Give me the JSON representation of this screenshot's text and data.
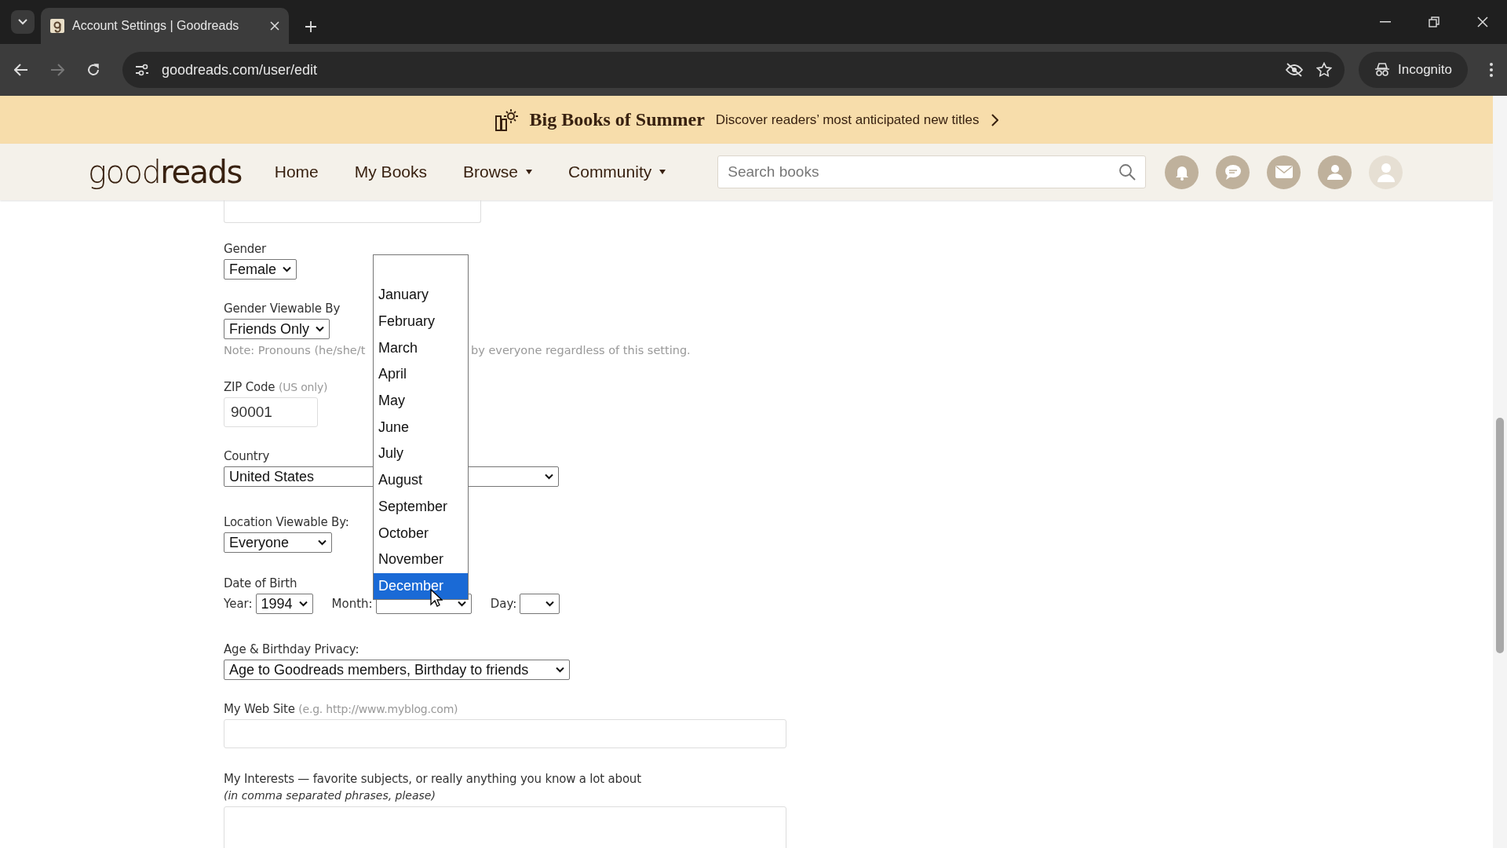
{
  "browser": {
    "tab_title": "Account Settings | Goodreads",
    "url": "goodreads.com/user/edit",
    "profile_label": "Incognito"
  },
  "banner": {
    "title": "Big Books of Summer",
    "text": "Discover readers’ most anticipated new titles"
  },
  "nav": {
    "logo_light": "good",
    "logo_bold": "reads",
    "links": [
      {
        "label": "Home",
        "has_menu": false
      },
      {
        "label": "My Books",
        "has_menu": false
      },
      {
        "label": "Browse",
        "has_menu": true
      },
      {
        "label": "Community",
        "has_menu": true
      }
    ],
    "search_placeholder": "Search books"
  },
  "form": {
    "gender": {
      "label": "Gender",
      "value": "Female"
    },
    "gender_viewable": {
      "label": "Gender Viewable By",
      "value": "Friends Only",
      "note_start": "Note: Pronouns (he/she/t",
      "note_end": "by everyone regardless of this setting."
    },
    "zip": {
      "label": "ZIP Code",
      "hint": "(US only)",
      "value": "90001"
    },
    "country": {
      "label": "Country",
      "value": "United States"
    },
    "location_viewable": {
      "label": "Location Viewable By:",
      "value": "Everyone"
    },
    "dob": {
      "label": "Date of Birth",
      "year_label": "Year:",
      "year_value": "1994",
      "month_label": "Month:",
      "day_label": "Day:"
    },
    "privacy": {
      "label": "Age & Birthday Privacy:",
      "value": "Age to Goodreads members, Birthday to friends"
    },
    "website": {
      "label": "My Web Site",
      "hint": "(e.g. http://www.myblog.com)"
    },
    "interests": {
      "label": "My Interests — favorite subjects, or really anything you know a lot about",
      "hint": "(in comma separated phrases, please)"
    }
  },
  "month_dropdown": {
    "options": [
      {
        "label": "January",
        "selected": false
      },
      {
        "label": "February",
        "selected": false
      },
      {
        "label": "March",
        "selected": false
      },
      {
        "label": "April",
        "selected": false
      },
      {
        "label": "May",
        "selected": false
      },
      {
        "label": "June",
        "selected": false
      },
      {
        "label": "July",
        "selected": false
      },
      {
        "label": "August",
        "selected": false
      },
      {
        "label": "September",
        "selected": false
      },
      {
        "label": "October",
        "selected": false
      },
      {
        "label": "November",
        "selected": false
      },
      {
        "label": "December",
        "selected": true
      }
    ]
  }
}
